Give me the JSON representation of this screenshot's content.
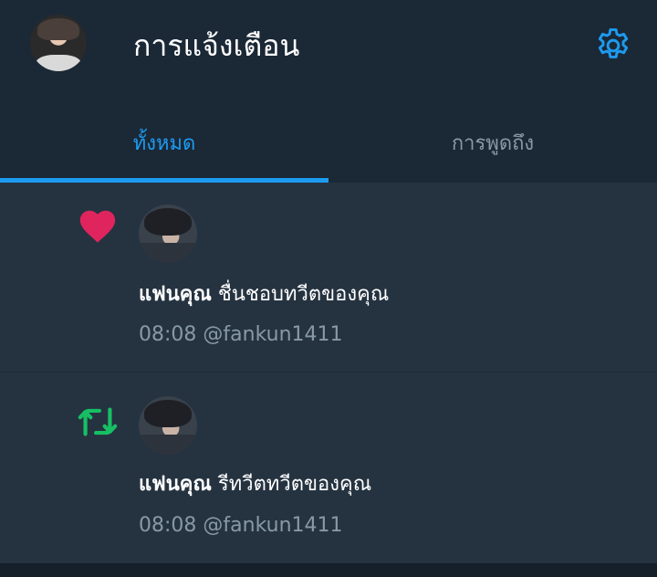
{
  "header": {
    "title": "การแจ้งเตือน",
    "settings_icon": "gear-icon",
    "accent_color": "#1d9bf0"
  },
  "tabs": [
    {
      "label": "ทั้งหมด",
      "active": true
    },
    {
      "label": "การพูดถึง",
      "active": false
    }
  ],
  "notifications": [
    {
      "type_icon": "heart-icon",
      "icon_color": "#e0245e",
      "user_name": "แฟนคุณ",
      "action": " ชื่นชอบทวีตของคุณ",
      "time": "08:08",
      "handle": "@fankun1411"
    },
    {
      "type_icon": "retweet-icon",
      "icon_color": "#17bf63",
      "user_name": "แฟนคุณ",
      "action": " รีทวีตทวีตของคุณ",
      "time": "08:08",
      "handle": "@fankun1411"
    }
  ]
}
